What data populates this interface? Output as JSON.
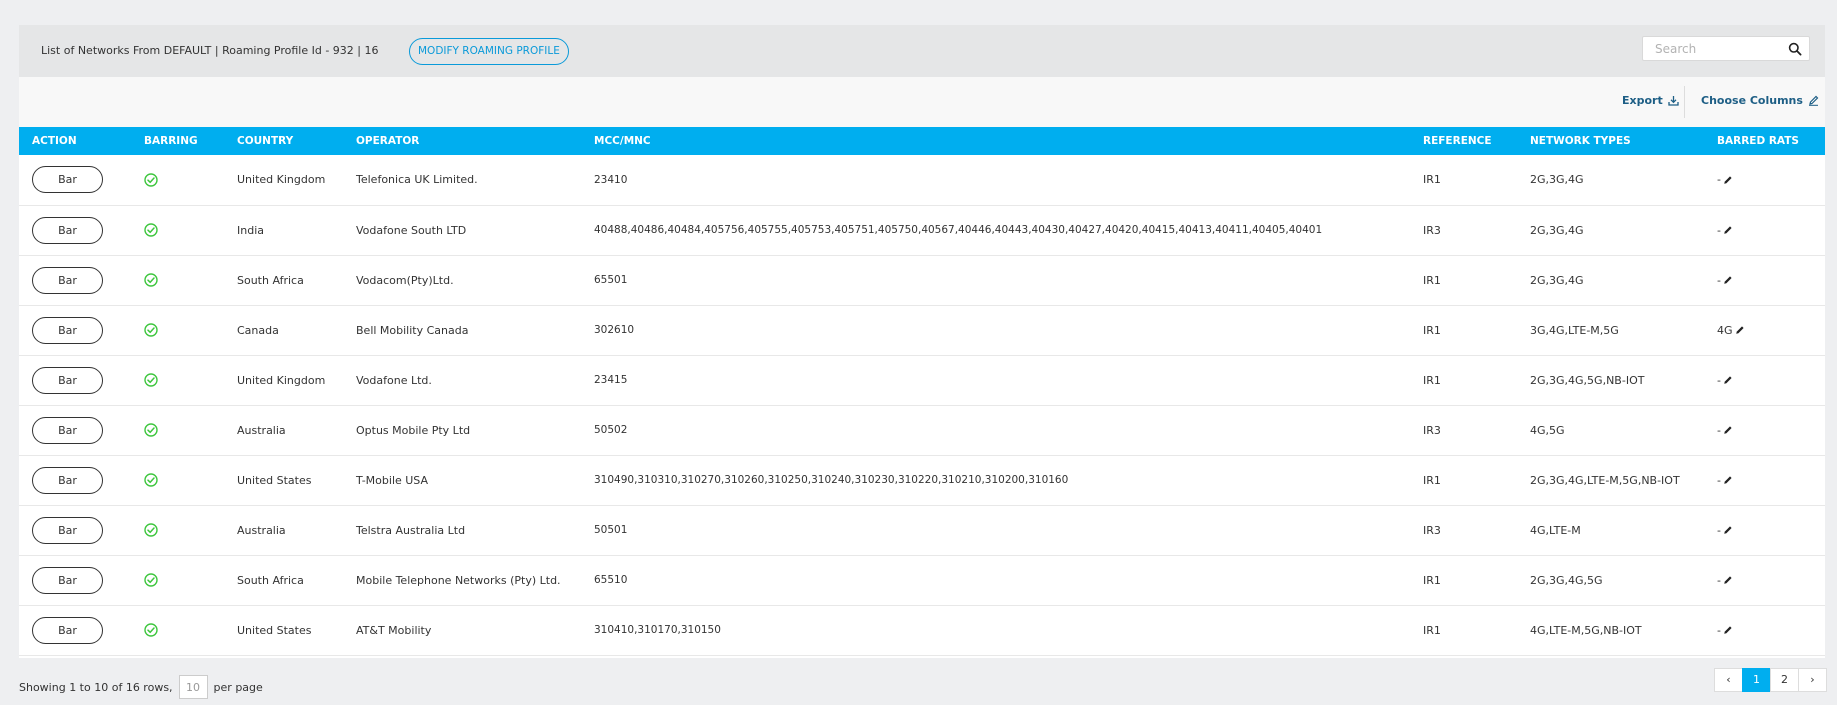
{
  "header": {
    "title": "List of Networks From DEFAULT | Roaming Profile Id - 932  |  16",
    "modify_button": "MODIFY ROAMING PROFILE",
    "search_placeholder": "Search"
  },
  "toolbar": {
    "export_label": "Export",
    "choose_columns_label": "Choose Columns"
  },
  "table": {
    "columns": [
      "ACTION",
      "BARRING",
      "COUNTRY",
      "OPERATOR",
      "MCC/MNC",
      "REFERENCE",
      "NETWORK TYPES",
      "BARRED RATS"
    ],
    "rows": [
      {
        "action": "Bar",
        "country": "United Kingdom",
        "operator": "Telefonica UK Limited.",
        "mcc_mnc": "23410",
        "reference": "IR1",
        "network_types": "2G,3G,4G",
        "barred_rats": "-"
      },
      {
        "action": "Bar",
        "country": "India",
        "operator": "Vodafone South LTD",
        "mcc_mnc": "40488,40486,40484,405756,405755,405753,405751,405750,40567,40446,40443,40430,40427,40420,40415,40413,40411,40405,40401",
        "reference": "IR3",
        "network_types": "2G,3G,4G",
        "barred_rats": "-"
      },
      {
        "action": "Bar",
        "country": "South Africa",
        "operator": "Vodacom(Pty)Ltd.",
        "mcc_mnc": "65501",
        "reference": "IR1",
        "network_types": "2G,3G,4G",
        "barred_rats": "-"
      },
      {
        "action": "Bar",
        "country": "Canada",
        "operator": "Bell Mobility Canada",
        "mcc_mnc": "302610",
        "reference": "IR1",
        "network_types": "3G,4G,LTE-M,5G",
        "barred_rats": "4G"
      },
      {
        "action": "Bar",
        "country": "United Kingdom",
        "operator": "Vodafone Ltd.",
        "mcc_mnc": "23415",
        "reference": "IR1",
        "network_types": "2G,3G,4G,5G,NB-IOT",
        "barred_rats": "-"
      },
      {
        "action": "Bar",
        "country": "Australia",
        "operator": "Optus Mobile Pty Ltd",
        "mcc_mnc": "50502",
        "reference": "IR3",
        "network_types": "4G,5G",
        "barred_rats": "-"
      },
      {
        "action": "Bar",
        "country": "United States",
        "operator": "T-Mobile USA",
        "mcc_mnc": "310490,310310,310270,310260,310250,310240,310230,310220,310210,310200,310160",
        "reference": "IR1",
        "network_types": "2G,3G,4G,LTE-M,5G,NB-IOT",
        "barred_rats": "-"
      },
      {
        "action": "Bar",
        "country": "Australia",
        "operator": "Telstra Australia Ltd",
        "mcc_mnc": "50501",
        "reference": "IR3",
        "network_types": "4G,LTE-M",
        "barred_rats": "-"
      },
      {
        "action": "Bar",
        "country": "South Africa",
        "operator": "Mobile Telephone Networks (Pty) Ltd.",
        "mcc_mnc": "65510",
        "reference": "IR1",
        "network_types": "2G,3G,4G,5G",
        "barred_rats": "-"
      },
      {
        "action": "Bar",
        "country": "United States",
        "operator": "AT&T Mobility",
        "mcc_mnc": "310410,310170,310150",
        "reference": "IR1",
        "network_types": "4G,LTE-M,5G,NB-IOT",
        "barred_rats": "-"
      }
    ]
  },
  "footer": {
    "showing_text": "Showing 1 to 10 of 16 rows,",
    "per_page_value": "10",
    "per_page_label": "per page",
    "pages": {
      "prev": "‹",
      "page1": "1",
      "page2": "2",
      "next": "›"
    }
  },
  "colors": {
    "accent": "#00aeef",
    "link": "#1d5e85",
    "check": "#3ec63e"
  },
  "icons": {
    "search": "search-icon",
    "export": "download-icon",
    "choose_columns": "pencil-icon",
    "barring": "check-circle-icon",
    "edit_rats": "pencil-icon"
  }
}
